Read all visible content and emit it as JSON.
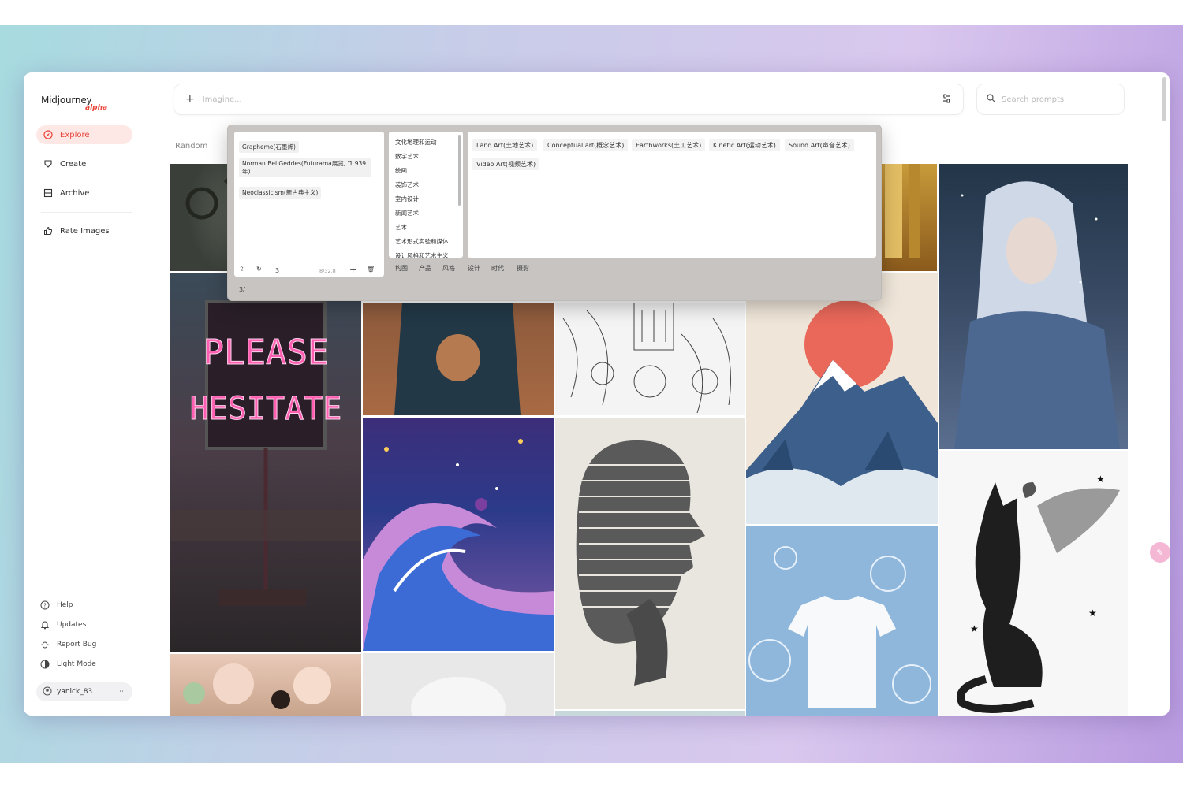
{
  "sidebar": {
    "logo": "Midjourney",
    "logo_tag": "alpha",
    "nav": [
      {
        "label": "Explore",
        "icon": "compass-icon",
        "active": true
      },
      {
        "label": "Create",
        "icon": "brush-icon"
      },
      {
        "label": "Archive",
        "icon": "archive-icon"
      },
      {
        "label": "Rate Images",
        "icon": "thumbs-up-icon"
      }
    ],
    "footer": [
      {
        "label": "Help",
        "icon": "help-icon"
      },
      {
        "label": "Updates",
        "icon": "bell-icon"
      },
      {
        "label": "Report Bug",
        "icon": "bug-icon"
      },
      {
        "label": "Light Mode",
        "icon": "sun-icon"
      }
    ],
    "user": "yanick_83"
  },
  "topbar": {
    "imagine_placeholder": "Imagine...",
    "search_placeholder": "Search prompts"
  },
  "tabs": {
    "current": "Random"
  },
  "popup": {
    "left_list": [
      "Grapheme(石墨烯)",
      "Norman Bel Geddes(Futurama展览, '1 939年)",
      "Neoclassicism(新古典主义)"
    ],
    "left_toolbar": {
      "count": "3",
      "status": "8/32.8"
    },
    "categories": [
      "文化地理和运动",
      "数字艺术",
      "绘画",
      "装饰艺术",
      "室内设计",
      "新闻艺术",
      "艺术",
      "艺术形式实验和媒体",
      "设计风格和艺术主义"
    ],
    "category_tabs": [
      "构图",
      "产品",
      "风格",
      "设计",
      "时代",
      "摄影"
    ],
    "tags": [
      "Land Art(土地艺术)",
      "Conceptual art(概念艺术)",
      "Earthworks(土工艺术)",
      "Kinetic Art(运动艺术)",
      "Sound Art(声音艺术)",
      "Video Art(视频艺术)"
    ],
    "footer_text": "3/"
  },
  "colors": {
    "accent": "#e8443a",
    "active_bg": "#fde8e6"
  },
  "gallery": {
    "neon_sign": [
      "PLEASE",
      "HESITATE"
    ]
  }
}
